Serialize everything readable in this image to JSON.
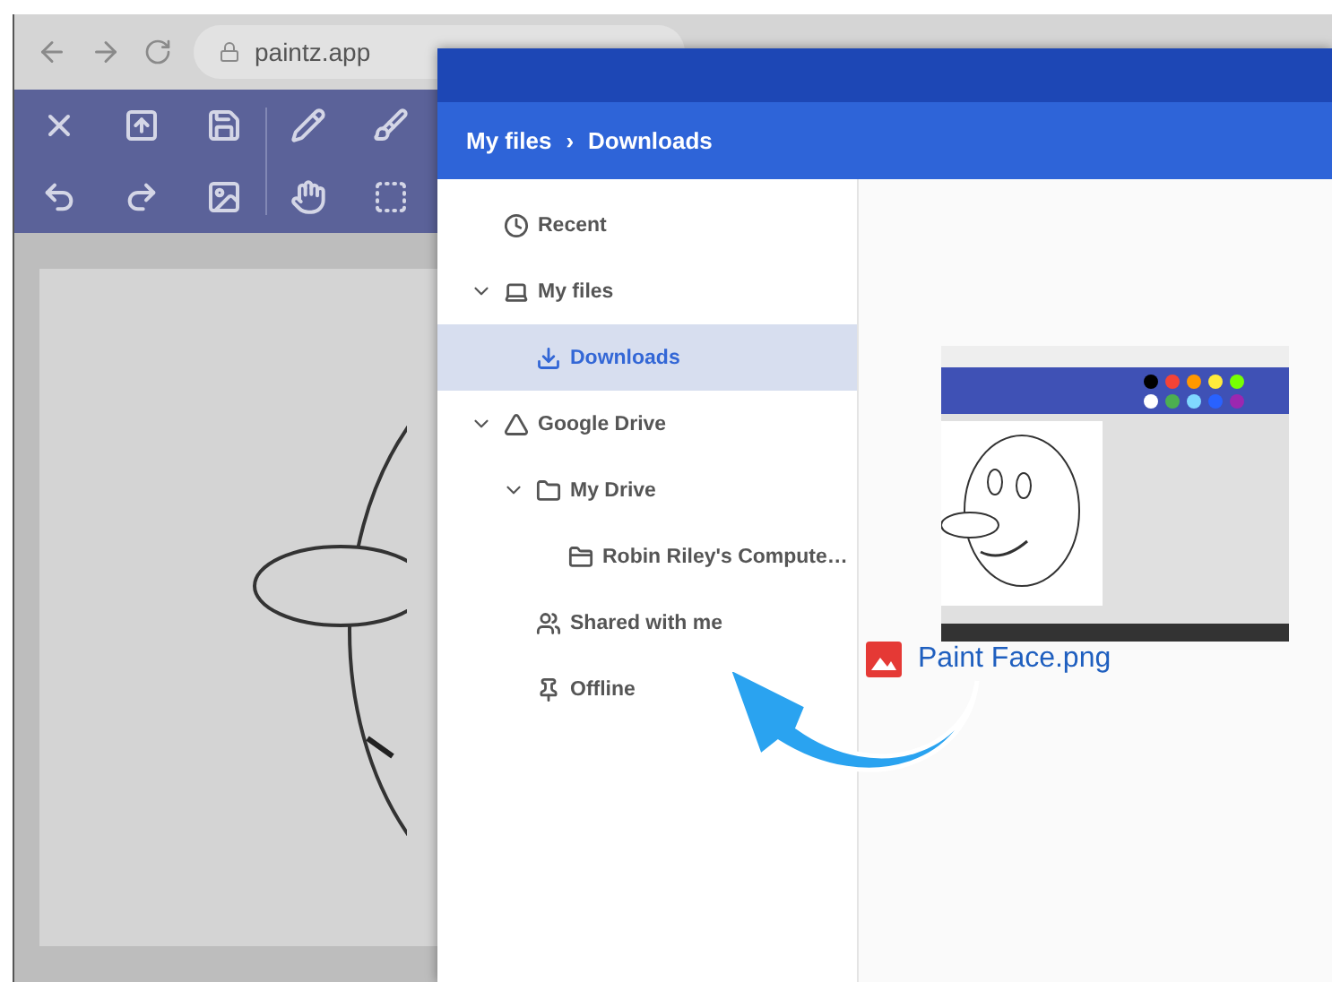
{
  "browser": {
    "address": "paintz.app"
  },
  "file_dialog": {
    "breadcrumb": [
      {
        "label": "My files"
      },
      {
        "label": "Downloads"
      }
    ],
    "breadcrumb_separator": "›",
    "sidebar": [
      {
        "label": "Recent",
        "kind": "recent",
        "selected": false
      },
      {
        "label": "My files",
        "kind": "computer",
        "selected": false,
        "expanded": true,
        "children": [
          {
            "label": "Downloads",
            "kind": "download",
            "selected": true
          }
        ]
      },
      {
        "label": "Google Drive",
        "kind": "drive",
        "selected": false,
        "expanded": true,
        "children": [
          {
            "label": "My Drive",
            "kind": "drive_folder",
            "selected": false,
            "expanded": true,
            "children": [
              {
                "label": "Robin Riley's Compute…",
                "kind": "shared_folder",
                "selected": false
              }
            ]
          },
          {
            "label": "Shared with me",
            "kind": "people",
            "selected": false
          },
          {
            "label": "Offline",
            "kind": "pin",
            "selected": false
          }
        ]
      }
    ],
    "file": {
      "name": "Paint Face.png"
    }
  }
}
